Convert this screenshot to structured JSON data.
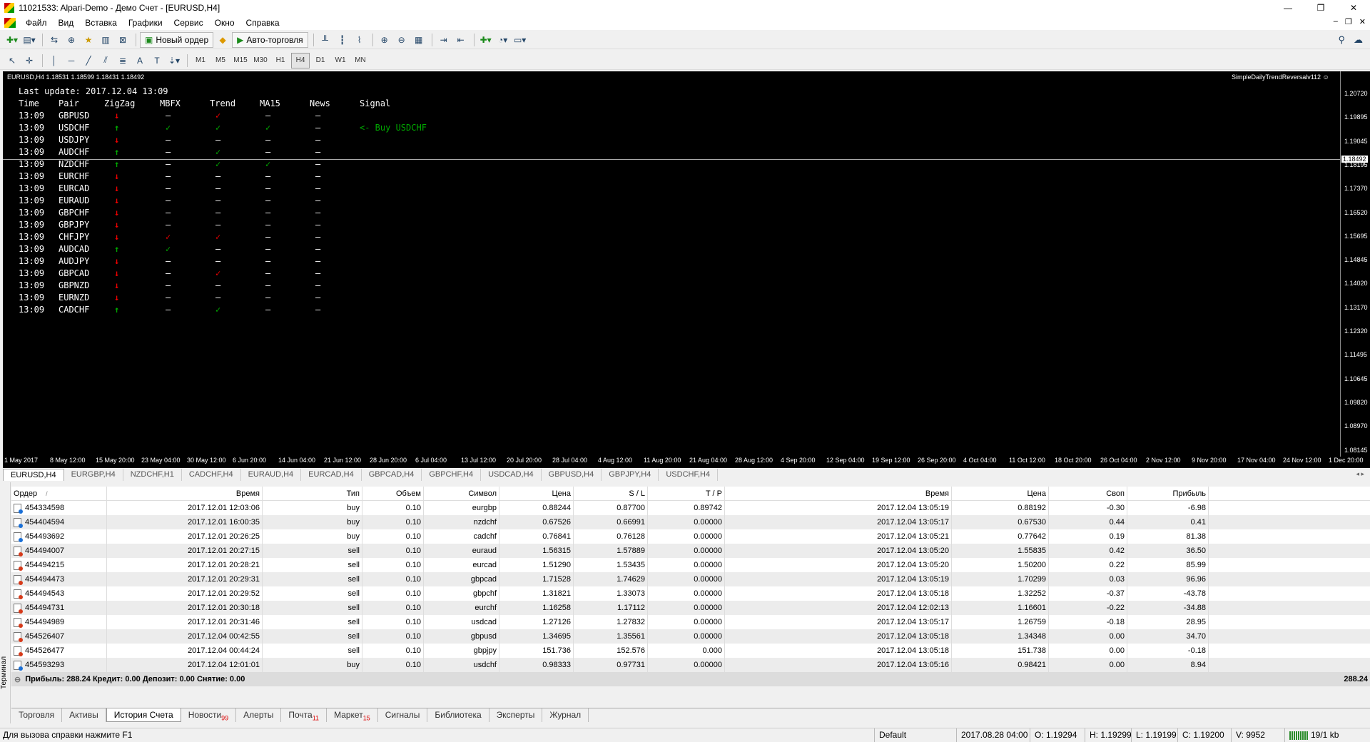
{
  "window": {
    "title": "11021533: Alpari-Demo - Демо Счет - [EURUSD,H4]"
  },
  "menu": [
    "Файл",
    "Вид",
    "Вставка",
    "Графики",
    "Сервис",
    "Окно",
    "Справка"
  ],
  "toolbar": {
    "new_order": "Новый ордер",
    "autotrading": "Авто-торговля",
    "timeframes": [
      "M1",
      "M5",
      "M15",
      "M30",
      "H1",
      "H4",
      "D1",
      "W1",
      "MN"
    ],
    "active_timeframe": "H4"
  },
  "chart": {
    "symbol_line": "EURUSD,H4  1.18531 1.18599 1.18431 1.18492",
    "ea_name": "SimpleDailyTrendReversalv112 ☺",
    "current_price": "1.18492",
    "y_labels": [
      "1.20720",
      "1.19895",
      "1.19045",
      "1.18195",
      "1.17370",
      "1.16520",
      "1.15695",
      "1.14845",
      "1.14020",
      "1.13170",
      "1.12320",
      "1.11495",
      "1.10645",
      "1.09820",
      "1.08970",
      "1.08145"
    ],
    "x_labels": [
      "1 May 2017",
      "8 May 12:00",
      "15 May 20:00",
      "23 May 04:00",
      "30 May 12:00",
      "6 Jun 20:00",
      "14 Jun 04:00",
      "21 Jun 12:00",
      "28 Jun 20:00",
      "6 Jul 04:00",
      "13 Jul 12:00",
      "20 Jul 20:00",
      "28 Jul 04:00",
      "4 Aug 12:00",
      "11 Aug 20:00",
      "21 Aug 04:00",
      "28 Aug 12:00",
      "4 Sep 20:00",
      "12 Sep 04:00",
      "19 Sep 12:00",
      "26 Sep 20:00",
      "4 Oct 04:00",
      "11 Oct 12:00",
      "18 Oct 20:00",
      "26 Oct 04:00",
      "2 Nov 12:00",
      "9 Nov 20:00",
      "17 Nov 04:00",
      "24 Nov 12:00",
      "1 Dec 20:00"
    ]
  },
  "panel": {
    "last_update": "Last update: 2017.12.04 13:09",
    "headers": {
      "time": "Time",
      "pair": "Pair",
      "zigzag": "ZigZag",
      "mbfx": "MBFX",
      "trend": "Trend",
      "ma15": "MA15",
      "news": "News",
      "signal": "Signal"
    },
    "rows": [
      {
        "time": "13:09",
        "pair": "GBPUSD",
        "zz": "down",
        "mbfx": "–",
        "trend": "red",
        "ma15": "–",
        "news": "–",
        "signal": ""
      },
      {
        "time": "13:09",
        "pair": "USDCHF",
        "zz": "up",
        "mbfx": "green",
        "trend": "green",
        "ma15": "green",
        "news": "–",
        "signal": "<- Buy USDCHF"
      },
      {
        "time": "13:09",
        "pair": "USDJPY",
        "zz": "down",
        "mbfx": "–",
        "trend": "–",
        "ma15": "–",
        "news": "–",
        "signal": ""
      },
      {
        "time": "13:09",
        "pair": "AUDCHF",
        "zz": "up",
        "mbfx": "–",
        "trend": "green",
        "ma15": "–",
        "news": "–",
        "signal": ""
      },
      {
        "time": "13:09",
        "pair": "NZDCHF",
        "zz": "up",
        "mbfx": "–",
        "trend": "green",
        "ma15": "green",
        "news": "–",
        "signal": ""
      },
      {
        "time": "13:09",
        "pair": "EURCHF",
        "zz": "down",
        "mbfx": "–",
        "trend": "–",
        "ma15": "–",
        "news": "–",
        "signal": ""
      },
      {
        "time": "13:09",
        "pair": "EURCAD",
        "zz": "down",
        "mbfx": "–",
        "trend": "–",
        "ma15": "–",
        "news": "–",
        "signal": ""
      },
      {
        "time": "13:09",
        "pair": "EURAUD",
        "zz": "down",
        "mbfx": "–",
        "trend": "–",
        "ma15": "–",
        "news": "–",
        "signal": ""
      },
      {
        "time": "13:09",
        "pair": "GBPCHF",
        "zz": "down",
        "mbfx": "–",
        "trend": "–",
        "ma15": "–",
        "news": "–",
        "signal": ""
      },
      {
        "time": "13:09",
        "pair": "GBPJPY",
        "zz": "down",
        "mbfx": "–",
        "trend": "–",
        "ma15": "–",
        "news": "–",
        "signal": ""
      },
      {
        "time": "13:09",
        "pair": "CHFJPY",
        "zz": "down",
        "mbfx": "red",
        "trend": "red",
        "ma15": "–",
        "news": "–",
        "signal": ""
      },
      {
        "time": "13:09",
        "pair": "AUDCAD",
        "zz": "up",
        "mbfx": "green",
        "trend": "–",
        "ma15": "–",
        "news": "–",
        "signal": ""
      },
      {
        "time": "13:09",
        "pair": "AUDJPY",
        "zz": "down",
        "mbfx": "–",
        "trend": "–",
        "ma15": "–",
        "news": "–",
        "signal": ""
      },
      {
        "time": "13:09",
        "pair": "GBPCAD",
        "zz": "down",
        "mbfx": "–",
        "trend": "red",
        "ma15": "–",
        "news": "–",
        "signal": ""
      },
      {
        "time": "13:09",
        "pair": "GBPNZD",
        "zz": "down",
        "mbfx": "–",
        "trend": "–",
        "ma15": "–",
        "news": "–",
        "signal": ""
      },
      {
        "time": "13:09",
        "pair": "EURNZD",
        "zz": "down",
        "mbfx": "–",
        "trend": "–",
        "ma15": "–",
        "news": "–",
        "signal": ""
      },
      {
        "time": "13:09",
        "pair": "CADCHF",
        "zz": "up",
        "mbfx": "–",
        "trend": "green",
        "ma15": "–",
        "news": "–",
        "signal": ""
      }
    ]
  },
  "chart_tabs": [
    "EURUSD,H4",
    "EURGBP,H4",
    "NZDCHF,H1",
    "CADCHF,H4",
    "EURAUD,H4",
    "EURCAD,H4",
    "GBPCAD,H4",
    "GBPCHF,H4",
    "USDCAD,H4",
    "GBPUSD,H4",
    "GBPJPY,H4",
    "USDCHF,H4"
  ],
  "terminal": {
    "side_label": "Терминал",
    "columns": [
      "Ордер",
      "/",
      "Время",
      "Тип",
      "Объем",
      "Символ",
      "Цена",
      "S / L",
      "T / P",
      "Время",
      "Цена",
      "Своп",
      "Прибыль"
    ],
    "rows": [
      [
        "454334598",
        "2017.12.01 12:03:06",
        "buy",
        "0.10",
        "eurgbp",
        "0.88244",
        "0.87700",
        "0.89742",
        "2017.12.04 13:05:19",
        "0.88192",
        "-0.30",
        "-6.98"
      ],
      [
        "454404594",
        "2017.12.01 16:00:35",
        "buy",
        "0.10",
        "nzdchf",
        "0.67526",
        "0.66991",
        "0.00000",
        "2017.12.04 13:05:17",
        "0.67530",
        "0.44",
        "0.41"
      ],
      [
        "454493692",
        "2017.12.01 20:26:25",
        "buy",
        "0.10",
        "cadchf",
        "0.76841",
        "0.76128",
        "0.00000",
        "2017.12.04 13:05:21",
        "0.77642",
        "0.19",
        "81.38"
      ],
      [
        "454494007",
        "2017.12.01 20:27:15",
        "sell",
        "0.10",
        "euraud",
        "1.56315",
        "1.57889",
        "0.00000",
        "2017.12.04 13:05:20",
        "1.55835",
        "0.42",
        "36.50"
      ],
      [
        "454494215",
        "2017.12.01 20:28:21",
        "sell",
        "0.10",
        "eurcad",
        "1.51290",
        "1.53435",
        "0.00000",
        "2017.12.04 13:05:20",
        "1.50200",
        "0.22",
        "85.99"
      ],
      [
        "454494473",
        "2017.12.01 20:29:31",
        "sell",
        "0.10",
        "gbpcad",
        "1.71528",
        "1.74629",
        "0.00000",
        "2017.12.04 13:05:19",
        "1.70299",
        "0.03",
        "96.96"
      ],
      [
        "454494543",
        "2017.12.01 20:29:52",
        "sell",
        "0.10",
        "gbpchf",
        "1.31821",
        "1.33073",
        "0.00000",
        "2017.12.04 13:05:18",
        "1.32252",
        "-0.37",
        "-43.78"
      ],
      [
        "454494731",
        "2017.12.01 20:30:18",
        "sell",
        "0.10",
        "eurchf",
        "1.16258",
        "1.17112",
        "0.00000",
        "2017.12.04 12:02:13",
        "1.16601",
        "-0.22",
        "-34.88"
      ],
      [
        "454494989",
        "2017.12.01 20:31:46",
        "sell",
        "0.10",
        "usdcad",
        "1.27126",
        "1.27832",
        "0.00000",
        "2017.12.04 13:05:17",
        "1.26759",
        "-0.18",
        "28.95"
      ],
      [
        "454526407",
        "2017.12.04 00:42:55",
        "sell",
        "0.10",
        "gbpusd",
        "1.34695",
        "1.35561",
        "0.00000",
        "2017.12.04 13:05:18",
        "1.34348",
        "0.00",
        "34.70"
      ],
      [
        "454526477",
        "2017.12.04 00:44:24",
        "sell",
        "0.10",
        "gbpjpy",
        "151.736",
        "152.576",
        "0.000",
        "2017.12.04 13:05:18",
        "151.738",
        "0.00",
        "-0.18"
      ],
      [
        "454593293",
        "2017.12.04 12:01:01",
        "buy",
        "0.10",
        "usdchf",
        "0.98333",
        "0.97731",
        "0.00000",
        "2017.12.04 13:05:16",
        "0.98421",
        "0.00",
        "8.94"
      ]
    ],
    "summary": "Прибыль: 288.24  Кредит: 0.00  Депозит: 0.00  Снятие: 0.00",
    "total": "288.24",
    "tabs": [
      {
        "label": "Торговля",
        "badge": ""
      },
      {
        "label": "Активы",
        "badge": ""
      },
      {
        "label": "История Счета",
        "badge": ""
      },
      {
        "label": "Новости",
        "badge": "99"
      },
      {
        "label": "Алерты",
        "badge": ""
      },
      {
        "label": "Почта",
        "badge": "11"
      },
      {
        "label": "Маркет",
        "badge": "15"
      },
      {
        "label": "Сигналы",
        "badge": ""
      },
      {
        "label": "Библиотека",
        "badge": ""
      },
      {
        "label": "Эксперты",
        "badge": ""
      },
      {
        "label": "Журнал",
        "badge": ""
      }
    ],
    "active_tab": "История Счета"
  },
  "status": {
    "help": "Для вызова справки нажмите F1",
    "profile": "Default",
    "datetime": "2017.08.28 04:00",
    "open": "O: 1.19294",
    "high": "H: 1.19299",
    "low": "L: 1.19199",
    "close": "C: 1.19200",
    "volume": "V: 9952",
    "traffic": "19/1 kb"
  }
}
